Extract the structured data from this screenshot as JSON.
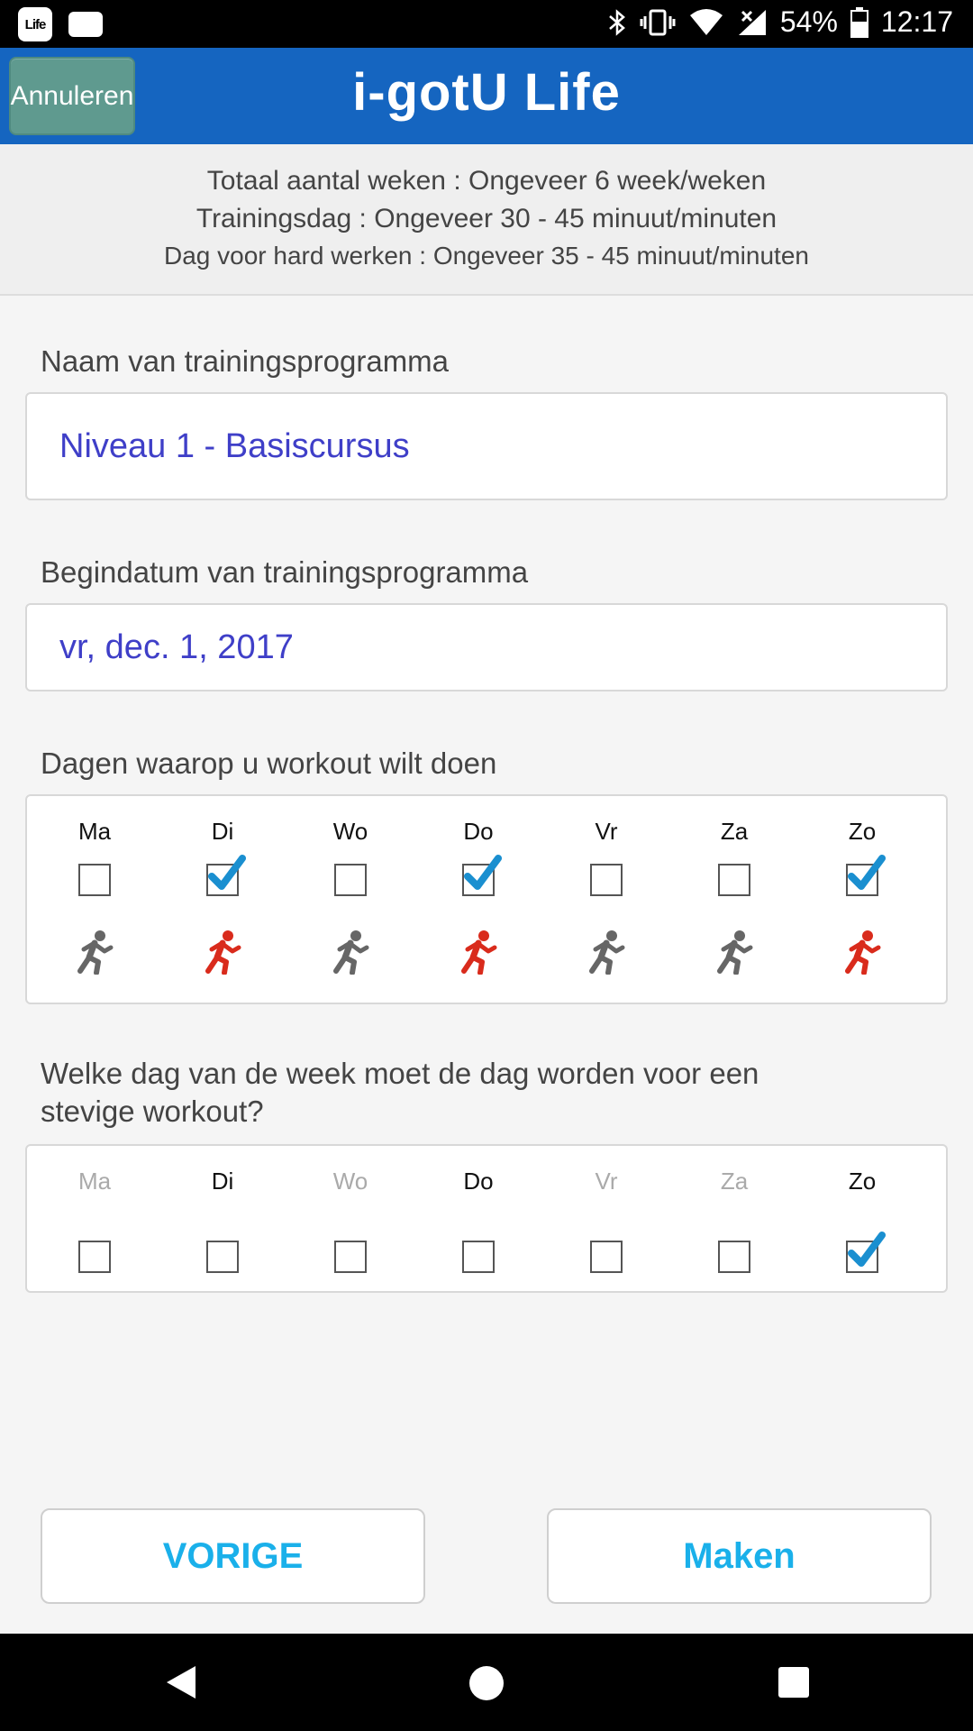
{
  "status_bar": {
    "app_icon_text": "Life",
    "battery": "54%",
    "time": "12:17"
  },
  "app_bar": {
    "cancel_label": "Annuleren",
    "title": "i-gotU Life"
  },
  "summary": {
    "line1": "Totaal aantal weken : Ongeveer 6 week/weken",
    "line2": "Trainingsdag : Ongeveer 30 - 45 minuut/minuten",
    "line3": "Dag voor hard werken : Ongeveer 35 - 45 minuut/minuten"
  },
  "program_name": {
    "label": "Naam van trainingsprogramma",
    "value": "Niveau 1 - Basiscursus"
  },
  "start_date": {
    "label": "Begindatum van trainingsprogramma",
    "value": "vr, dec. 1, 2017"
  },
  "workout_days": {
    "label": "Dagen waarop u workout wilt doen",
    "days": [
      {
        "name": "Ma",
        "checked": false
      },
      {
        "name": "Di",
        "checked": true
      },
      {
        "name": "Wo",
        "checked": false
      },
      {
        "name": "Do",
        "checked": true
      },
      {
        "name": "Vr",
        "checked": false
      },
      {
        "name": "Za",
        "checked": false
      },
      {
        "name": "Zo",
        "checked": true
      }
    ]
  },
  "hard_day": {
    "label": "Welke dag van de week moet de dag worden voor een stevige workout?",
    "days": [
      {
        "name": "Ma",
        "enabled": false,
        "checked": false
      },
      {
        "name": "Di",
        "enabled": true,
        "checked": false
      },
      {
        "name": "Wo",
        "enabled": false,
        "checked": false
      },
      {
        "name": "Do",
        "enabled": true,
        "checked": false
      },
      {
        "name": "Vr",
        "enabled": false,
        "checked": false
      },
      {
        "name": "Za",
        "enabled": false,
        "checked": false
      },
      {
        "name": "Zo",
        "enabled": true,
        "checked": true
      }
    ]
  },
  "buttons": {
    "previous": "VORIGE",
    "create": "Maken"
  },
  "colors": {
    "app_bar": "#1565c0",
    "field_text": "#3f3fc8",
    "button_text": "#1ab0ea",
    "runner_active": "#d92b1c",
    "runner_inactive": "#666666",
    "check": "#1a8fd0"
  },
  "icons": {
    "runner": "runner-icon",
    "check": "checkmark-icon"
  }
}
